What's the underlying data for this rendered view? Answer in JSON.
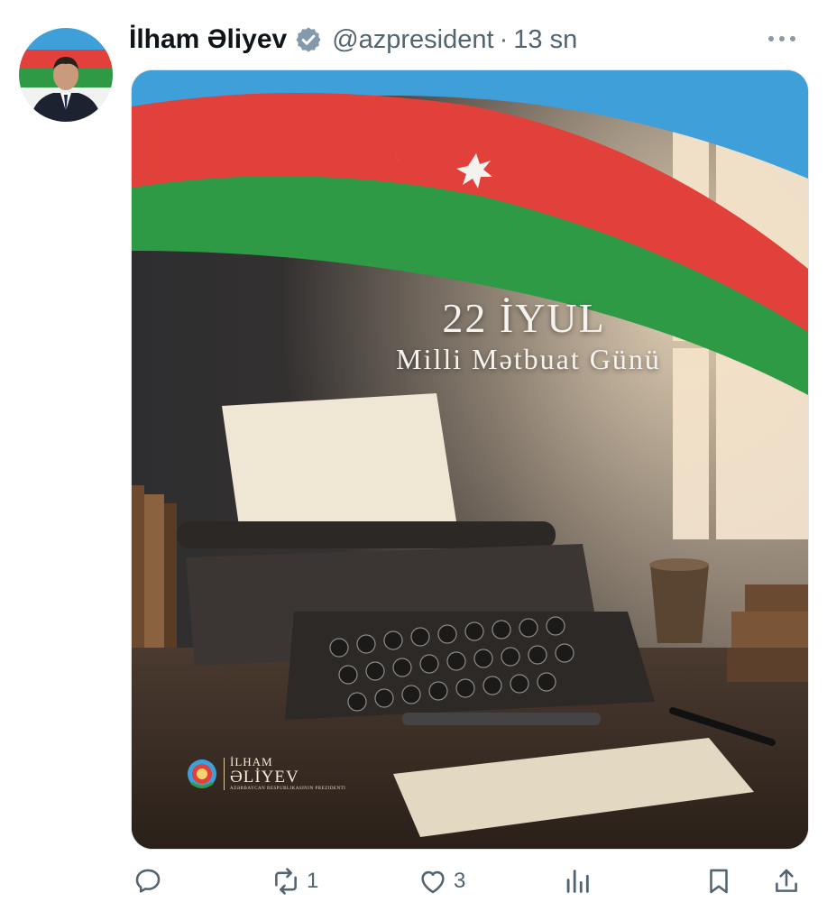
{
  "tweet": {
    "author_name": "İlham Əliyev",
    "handle": "@azpresident",
    "separator": "·",
    "time": "13 sn"
  },
  "icons": {
    "verified": "verified-badge-icon",
    "more": "more-options-icon",
    "reply": "reply-icon",
    "retweet": "retweet-icon",
    "like": "heart-icon",
    "views": "views-icon",
    "bookmark": "bookmark-icon",
    "share": "share-icon"
  },
  "media": {
    "line1": "22 İYUL",
    "line2": "Milli Mətbuat Günü",
    "logo_name1": "İLHAM",
    "logo_name2": "ƏLİYEV",
    "logo_sub": "AZƏRBAYCAN RESPUBLİKASININ PREZİDENTİ"
  },
  "actions": {
    "retweet_count": "1",
    "like_count": "3"
  },
  "colors": {
    "flag_blue": "#3f9fd9",
    "flag_red": "#e2403a",
    "flag_green": "#2f9a46",
    "text_secondary": "#536471"
  }
}
